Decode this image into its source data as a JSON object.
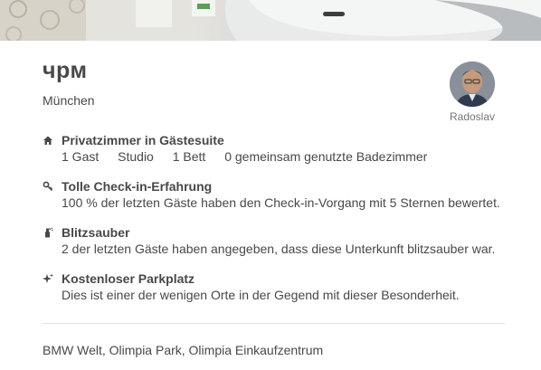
{
  "listing": {
    "title": "чрм",
    "location": "München"
  },
  "host": {
    "name": "Radoslav"
  },
  "highlights": [
    {
      "icon": "home-icon",
      "title": "Privatzimmer in Gästesuite",
      "facts": [
        "1 Gast",
        "Studio",
        "1 Bett",
        "0 gemeinsam genutzte Badezimmer"
      ]
    },
    {
      "icon": "key-icon",
      "title": "Tolle Check-in-Erfahrung",
      "text": "100 % der letzten Gäste haben den Check-in-Vorgang mit 5 Sternen bewertet."
    },
    {
      "icon": "spray-bottle-icon",
      "title": "Blitzsauber",
      "text": "2 der letzten Gäste haben angegeben, dass diese Unterkunft blitzsauber war."
    },
    {
      "icon": "sparkle-icon",
      "title": "Kostenloser Parkplatz",
      "text": "Dies ist einer der wenigen Orte in der Gegend mit dieser Besonderheit."
    }
  ],
  "neighborhood": "BMW Welt, Olimpia Park, Olimpia Einkaufzentrum"
}
